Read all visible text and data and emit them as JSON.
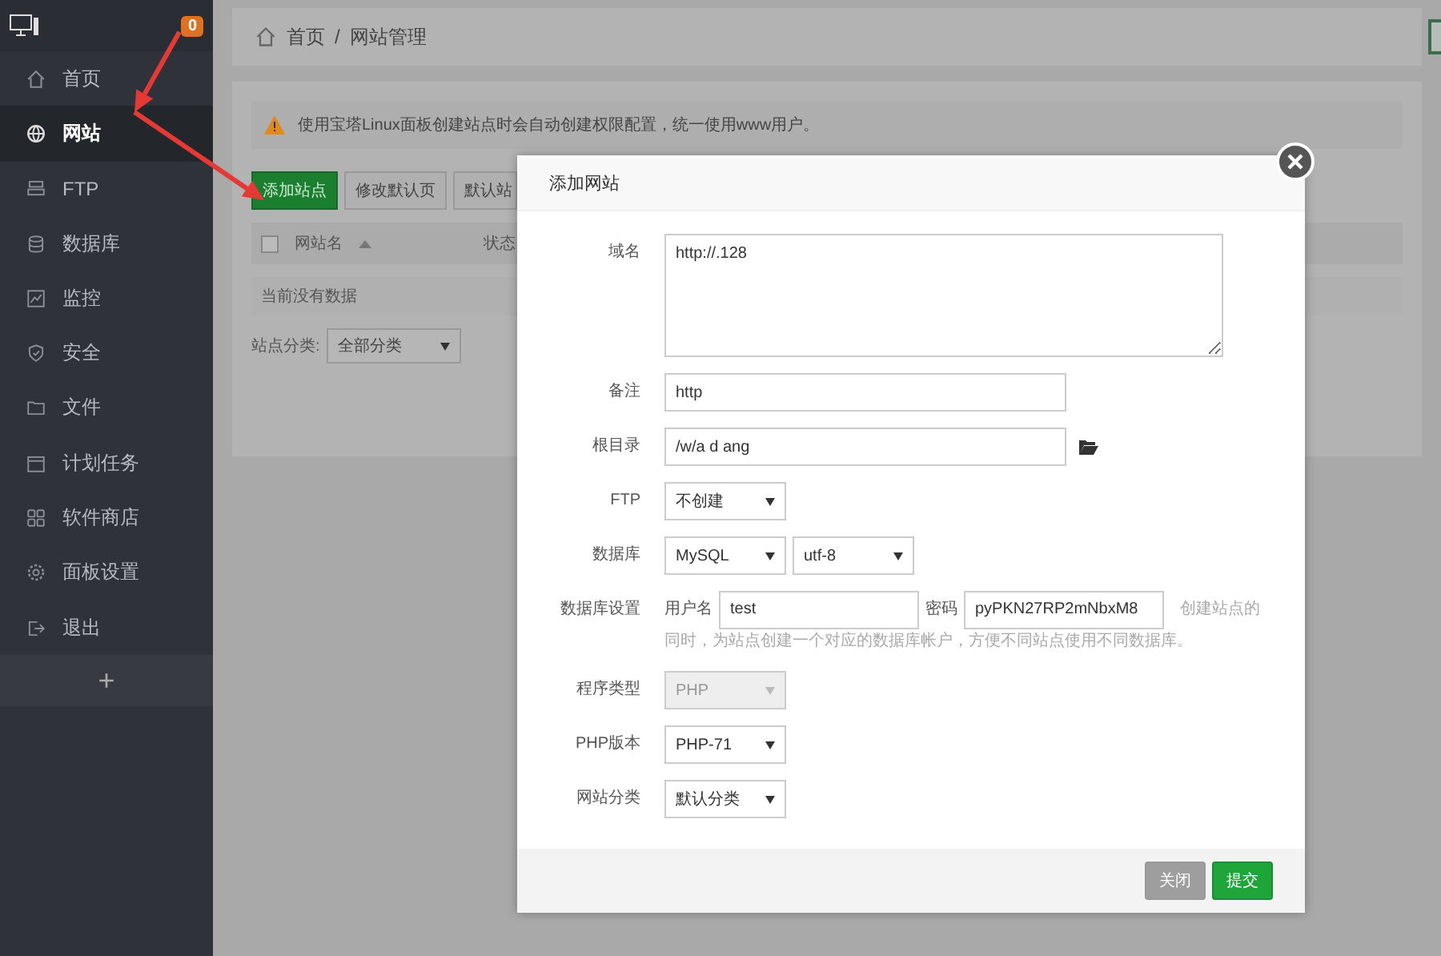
{
  "sidebar": {
    "badge": "0",
    "items": [
      {
        "label": "首页",
        "kind": "home",
        "selected": false
      },
      {
        "label": "网站",
        "kind": "globe",
        "selected": true
      },
      {
        "label": "FTP",
        "kind": "ftp",
        "selected": false
      },
      {
        "label": "数据库",
        "kind": "database",
        "selected": false
      },
      {
        "label": "监控",
        "kind": "monitor",
        "selected": false
      },
      {
        "label": "安全",
        "kind": "shield",
        "selected": false
      },
      {
        "label": "文件",
        "kind": "folder",
        "selected": false
      },
      {
        "label": "计划任务",
        "kind": "calendar",
        "selected": false
      },
      {
        "label": "软件商店",
        "kind": "grid",
        "selected": false
      },
      {
        "label": "面板设置",
        "kind": "gear",
        "selected": false
      },
      {
        "label": "退出",
        "kind": "exit",
        "selected": false
      }
    ],
    "add": "+"
  },
  "breadcrumb": [
    "首页",
    "/",
    "网站管理"
  ],
  "alert": "使用宝塔Linux面板创建站点时会自动创建权限配置，统一使用www用户。",
  "toolbar": [
    {
      "label": "添加站点",
      "kind": "primary"
    },
    {
      "label": "修改默认页",
      "kind": "default"
    },
    {
      "label": "默认站",
      "kind": "default"
    }
  ],
  "table": {
    "select_all_checked": false,
    "columns": [
      {
        "label": "网站名",
        "sorted": true
      },
      {
        "label": "状态",
        "sorted": false
      }
    ],
    "empty": "当前没有数据"
  },
  "category_filter": {
    "label": "站点分类:",
    "value": "全部分类"
  },
  "dialog": {
    "title": "添加网站",
    "fields": [
      {
        "kind": "textarea",
        "label": "域名",
        "value": "http://.128"
      },
      {
        "kind": "text",
        "label": "备注",
        "value": "http"
      },
      {
        "kind": "path",
        "label": "根目录",
        "value": "/w/a d ang"
      },
      {
        "kind": "select",
        "label": "FTP",
        "selects": [
          {
            "value": "不创建",
            "disabled": false
          }
        ]
      },
      {
        "kind": "select",
        "label": "数据库",
        "selects": [
          {
            "value": "MySQL",
            "disabled": false
          },
          {
            "value": "utf-8",
            "disabled": false
          }
        ]
      },
      {
        "kind": "credentials",
        "label": "数据库设置",
        "user_label": "用户名",
        "user": "test",
        "pass_label": "密码",
        "pass": "pyPKN27RP2mNbxM8",
        "help": [
          "创建站点的",
          "同时，为站点创建一个对应的数据库帐户，方便不同站点使用不同数据库。"
        ]
      },
      {
        "kind": "select",
        "label": "程序类型",
        "selects": [
          {
            "value": "PHP",
            "disabled": true
          }
        ]
      },
      {
        "kind": "select",
        "label": "PHP版本",
        "selects": [
          {
            "value": "PHP-71",
            "disabled": false
          }
        ]
      },
      {
        "kind": "select",
        "label": "网站分类",
        "selects": [
          {
            "value": "默认分类",
            "disabled": false
          }
        ]
      }
    ],
    "buttons": [
      {
        "label": "关闭",
        "disabled": true
      },
      {
        "label": "提交",
        "disabled": false
      }
    ]
  }
}
